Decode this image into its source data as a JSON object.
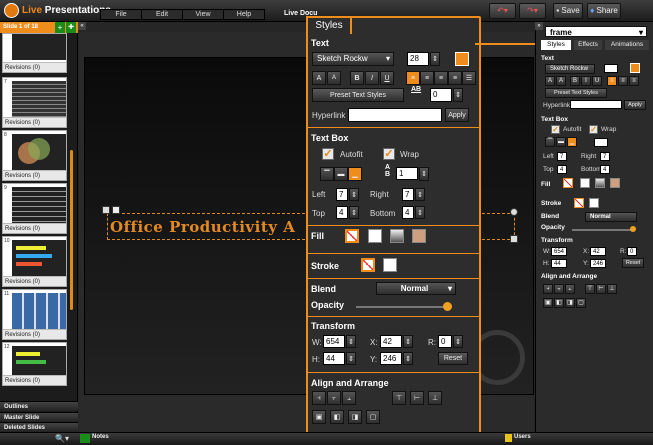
{
  "app": {
    "title_a": "Live",
    "title_b": " Presentations"
  },
  "menu": [
    "File",
    "Edit",
    "View",
    "Help"
  ],
  "doc_title": "Live Docu",
  "toolbar": {
    "save": "Save",
    "share": "Share"
  },
  "left_panel": {
    "header": "Slide 1 of 18",
    "slides": [
      {
        "num": "",
        "rev": "Revisions (0)"
      },
      {
        "num": "7",
        "rev": "Revisions (0)"
      },
      {
        "num": "8",
        "rev": "Revisions (0)"
      },
      {
        "num": "9",
        "rev": "Revisions (0)"
      },
      {
        "num": "10",
        "rev": "Revisions (0)"
      },
      {
        "num": "11",
        "rev": "Revisions (0)"
      },
      {
        "num": "12",
        "rev": "Revisions (0)"
      }
    ],
    "sections": [
      "Outlines",
      "Master Slide",
      "Deleted Slides"
    ]
  },
  "canvas": {
    "text": "Office Productivity A"
  },
  "styles_panel": {
    "tab": "Styles",
    "text": {
      "heading": "Text",
      "font": "Sketch Rockw",
      "size": "28",
      "preset": "Preset Text Styles",
      "spacing": "0",
      "hyperlink_label": "Hyperlink",
      "apply": "Apply",
      "color": "#ef8d1c",
      "bold": "B",
      "italic": "I",
      "underline": "U",
      "grow": "A",
      "shrink": "A",
      "spacing_icon": "AB"
    },
    "textbox": {
      "heading": "Text Box",
      "autofit": "Autofit",
      "wrap": "Wrap",
      "columns": "1",
      "left_label": "Left",
      "left": "7",
      "right_label": "Right",
      "right": "7",
      "top_label": "Top",
      "top": "4",
      "bottom_label": "Bottom",
      "bottom": "4"
    },
    "fill": {
      "heading": "Fill"
    },
    "stroke": {
      "heading": "Stroke"
    },
    "blend": {
      "heading": "Blend",
      "mode": "Normal",
      "opacity_label": "Opacity",
      "opacity": 1.0
    },
    "transform": {
      "heading": "Transform",
      "w_label": "W:",
      "w": "654",
      "h_label": "H:",
      "h": "44",
      "x_label": "X:",
      "x": "42",
      "y_label": "Y:",
      "y": "246",
      "r_label": "R:",
      "r": "0",
      "reset": "Reset"
    },
    "align": {
      "heading": "Align and Arrange"
    }
  },
  "right_panel": {
    "object": "frame",
    "tabs": [
      "Styles",
      "Effects",
      "Animations"
    ],
    "text_heading": "Text",
    "font": "Sketch Rockw",
    "preset": "Preset Text Styles",
    "hyperlink": "Hyperlink",
    "apply": "Apply",
    "textbox_heading": "Text Box",
    "autofit": "Autofit",
    "wrap": "Wrap",
    "left_label": "Left",
    "left": "7",
    "right_label": "Right",
    "right": "7",
    "top_label": "Top",
    "top": "4",
    "bottom_label": "Bottom",
    "bottom": "4",
    "fill": "Fill",
    "stroke": "Stroke",
    "blend": "Blend",
    "mode": "Normal",
    "opacity": "Opacity",
    "transform": "Transform",
    "w_label": "W:",
    "w": "654",
    "h_label": "H:",
    "h": "44",
    "x_label": "X:",
    "x": "42",
    "y_label": "Y:",
    "y": "246",
    "r_label": "R:",
    "r": "0",
    "reset": "Reset",
    "align": "Align and Arrange"
  },
  "bottom": {
    "notes": "Notes",
    "users": "Users"
  }
}
